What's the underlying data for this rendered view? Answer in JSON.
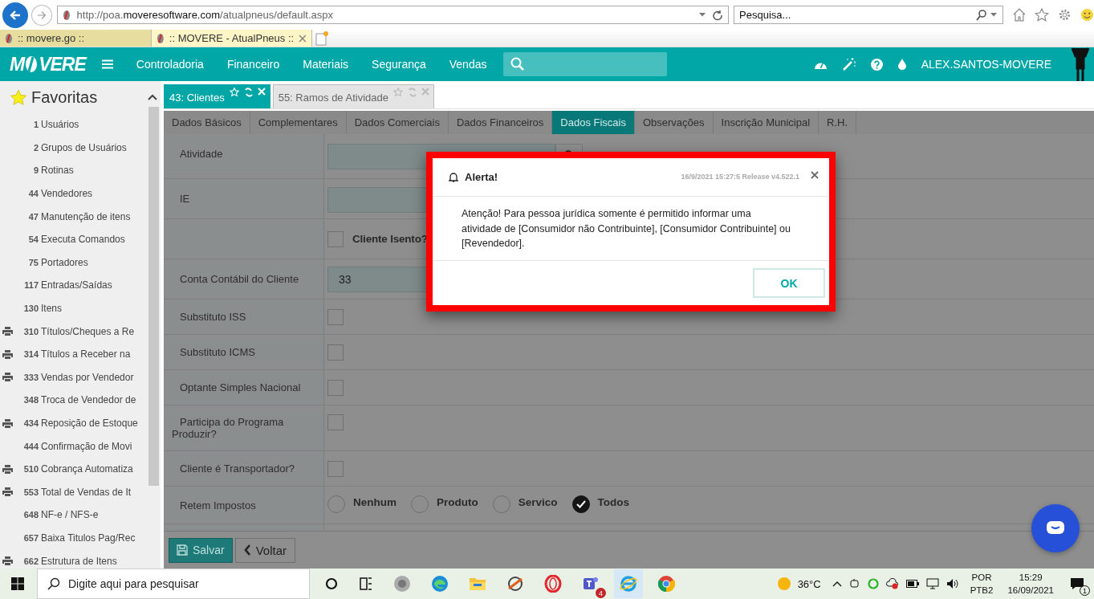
{
  "browser": {
    "url": "http://poa.**moveresoftware.com**/atualpneus/default.aspx",
    "search": {
      "placeholder": "Pesquisa..."
    },
    "tabs": [
      {
        "title": ":: movere.go ::",
        "selected": false
      },
      {
        "title": ":: MOVERE - AtualPneus ::",
        "selected": true
      }
    ]
  },
  "header": {
    "logo_left": "M",
    "logo_right": "VERE",
    "menu": [
      "Controladoria",
      "Financeiro",
      "Materiais",
      "Segurança",
      "Vendas"
    ],
    "user": "ALEX.SANTOS-MOVERE"
  },
  "sidebar": {
    "title": "Favoritas",
    "items": [
      {
        "number": "1",
        "label": "Usuários",
        "printer": false
      },
      {
        "number": "2",
        "label": "Grupos de Usuários",
        "printer": false
      },
      {
        "number": "9",
        "label": "Rotinas",
        "printer": false
      },
      {
        "number": "44",
        "label": "Vendedores",
        "printer": false
      },
      {
        "number": "47",
        "label": "Manutenção de itens",
        "printer": false
      },
      {
        "number": "54",
        "label": "Executa Comandos",
        "printer": false
      },
      {
        "number": "75",
        "label": "Portadores",
        "printer": false
      },
      {
        "number": "117",
        "label": "Entradas/Saídas",
        "printer": false
      },
      {
        "number": "130",
        "label": "Itens",
        "printer": false
      },
      {
        "number": "310",
        "label": "Títulos/Cheques a Re",
        "printer": true
      },
      {
        "number": "314",
        "label": "Títulos a Receber na",
        "printer": true
      },
      {
        "number": "333",
        "label": "Vendas por Vendedor",
        "printer": true
      },
      {
        "number": "348",
        "label": "Troca de Vendedor de",
        "printer": false
      },
      {
        "number": "434",
        "label": "Reposição de Estoque",
        "printer": true
      },
      {
        "number": "444",
        "label": "Confirmação de Movi",
        "printer": false
      },
      {
        "number": "510",
        "label": "Cobrança Automatiza",
        "printer": true
      },
      {
        "number": "553",
        "label": "Total de Vendas de It",
        "printer": true
      },
      {
        "number": "648",
        "label": "NF-e / NFS-e",
        "printer": false
      },
      {
        "number": "657",
        "label": "Baixa Titulos Pag/Rec",
        "printer": false
      },
      {
        "number": "662",
        "label": "Estrutura de Itens",
        "printer": true
      }
    ]
  },
  "tabs": [
    {
      "label": "43: Clientes",
      "selected": true
    },
    {
      "label": "55: Ramos de Atividade",
      "selected": false
    }
  ],
  "subtabs": [
    {
      "label": "Dados Básicos",
      "selected": false
    },
    {
      "label": "Complementares",
      "selected": false
    },
    {
      "label": "Dados Comerciais",
      "selected": false
    },
    {
      "label": "Dados Financeiros",
      "selected": false
    },
    {
      "label": "Dados Fiscais",
      "selected": true
    },
    {
      "label": "Observações",
      "selected": false
    },
    {
      "label": "Inscrição Municipal",
      "selected": false
    },
    {
      "label": "R.H.",
      "selected": false
    }
  ],
  "form": [
    {
      "kind": "lookup",
      "label": "Atividade"
    },
    {
      "kind": "text",
      "label": "IE"
    },
    {
      "kind": "inline_check",
      "text": "Cliente Isento?",
      "checked": false
    },
    {
      "kind": "text",
      "label": "Conta Contábil do Cliente",
      "value": "33"
    },
    {
      "kind": "checkbox",
      "label": "Substituto ISS",
      "checked": false
    },
    {
      "kind": "checkbox",
      "label": "Substituto ICMS",
      "checked": false
    },
    {
      "kind": "checkbox",
      "label": "Optante Simples Nacional",
      "checked": false
    },
    {
      "kind": "checkbox",
      "label": "Participa do Programa Produzir?",
      "checked": false
    },
    {
      "kind": "checkbox",
      "label": "Cliente é Transportador?",
      "checked": false
    },
    {
      "kind": "radio",
      "label": "Retem Impostos",
      "options": [
        {
          "label": "Nenhum",
          "selected": false
        },
        {
          "label": "Produto",
          "selected": false
        },
        {
          "label": "Servico",
          "selected": false
        },
        {
          "label": "Todos",
          "selected": true
        }
      ]
    }
  ],
  "buttons": [
    "Salvar",
    "Voltar"
  ],
  "dialog": {
    "title": "Alerta!",
    "meta": "16/9/2021 15:27:5 Release v4.522.1",
    "message": "Atenção! Para pessoa jurídica somente é permitido informar uma atividade de [Consumidor não Contribuinte], [Consumidor Contribuinte] ou [Revendedor].",
    "button": "OK"
  },
  "taskbar": {
    "search": {
      "placeholder": "Digite aqui para pesquisar"
    },
    "teams_badge": "4",
    "temperature": "36°C",
    "lang": "POR",
    "layout": "PTB2",
    "time": "15:29",
    "date": "16/09/2021",
    "notifications": "1"
  }
}
